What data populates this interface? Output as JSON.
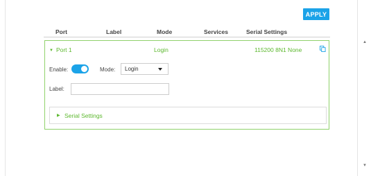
{
  "toolbar": {
    "apply_label": "APPLY"
  },
  "table": {
    "headers": [
      "Port",
      "Label",
      "Mode",
      "Services",
      "Serial Settings"
    ],
    "row": {
      "port": "Port 1",
      "mode": "Login",
      "serial": "115200 8N1 None"
    }
  },
  "form": {
    "enable_label": "Enable:",
    "enable_on": true,
    "mode_label": "Mode:",
    "mode_value": "Login",
    "label_label": "Label:",
    "label_value": "",
    "label_placeholder": ""
  },
  "serial_section": {
    "title": "Serial Settings"
  },
  "colors": {
    "accent": "#1ba3e8",
    "green": "#5cb82e",
    "card_border": "#8fd16a"
  },
  "icons": {
    "row_caret": "caret-down-icon",
    "copy": "copy-icon",
    "section_caret": "caret-right-icon"
  }
}
